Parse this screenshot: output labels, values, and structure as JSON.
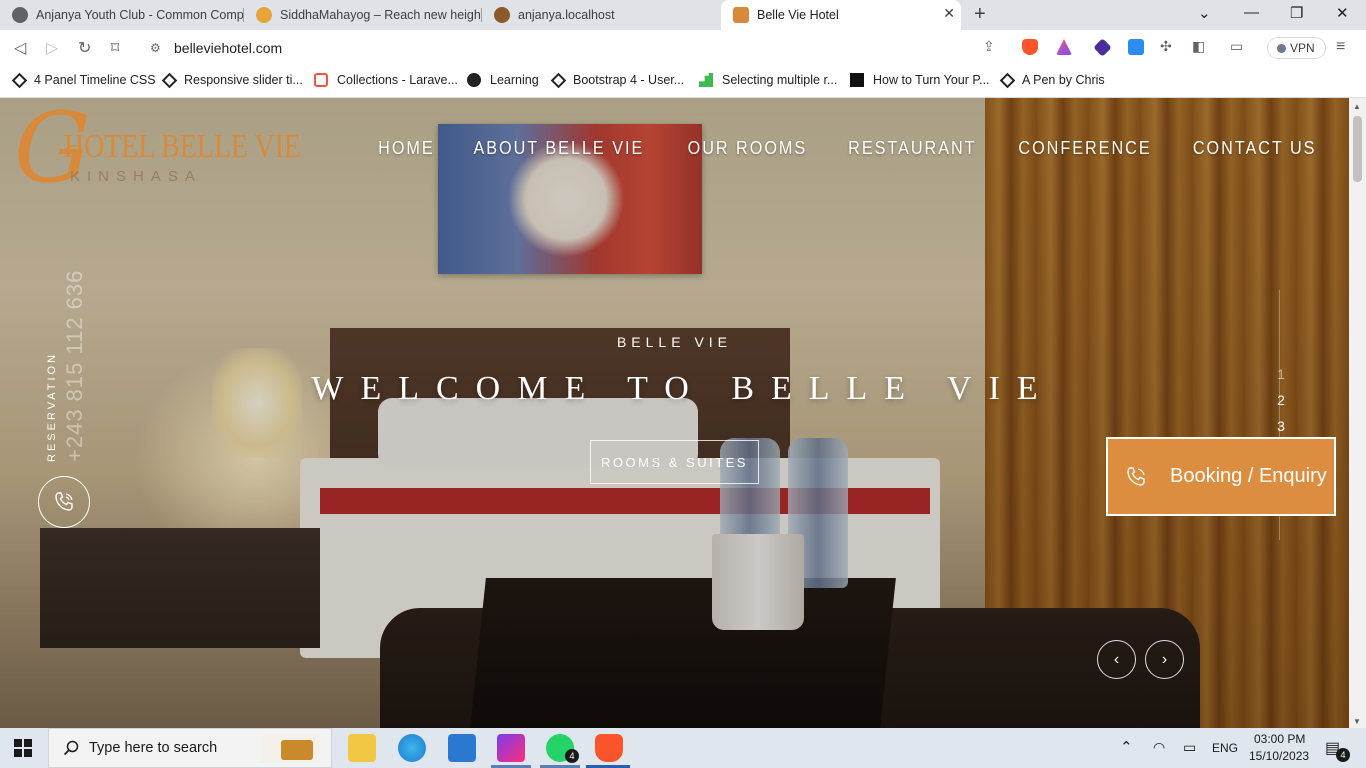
{
  "browser": {
    "tabs": [
      {
        "title": "Anjanya Youth Club - Common Comp",
        "favicon": "globe-icon",
        "active": false
      },
      {
        "title": "SiddhaMahayog – Reach new heights",
        "favicon": "siddhamahayog-icon",
        "active": false
      },
      {
        "title": "anjanya.localhost",
        "favicon": "anjanya-icon",
        "active": false
      },
      {
        "title": "Belle Vie Hotel",
        "favicon": "bellevie-icon",
        "active": true
      }
    ],
    "address": "belleviehotel.com",
    "vpn_label": "VPN",
    "bookmarks": [
      {
        "label": "4 Panel Timeline CSS",
        "icon": "codepen-icon"
      },
      {
        "label": "Responsive slider ti...",
        "icon": "codepen-icon"
      },
      {
        "label": "Collections - Larave...",
        "icon": "laravel-icon"
      },
      {
        "label": "Learning",
        "icon": "learning-icon"
      },
      {
        "label": "Bootstrap 4 - User...",
        "icon": "codepen-icon"
      },
      {
        "label": "Selecting multiple r...",
        "icon": "stackoverflow-icon"
      },
      {
        "label": "How to Turn Your P...",
        "icon": "medium-icon"
      },
      {
        "label": "A Pen by Chris",
        "icon": "codepen-icon"
      }
    ]
  },
  "site": {
    "logo": {
      "initial": "G",
      "main": "HOTEL BELLE VIE",
      "sub": "KINSHASA"
    },
    "nav": [
      "HOME",
      "ABOUT BELLE VIE",
      "OUR ROOMS",
      "RESTAURANT",
      "CONFERENCE",
      "CONTACT US"
    ],
    "reservation_label": "RESERVATION",
    "reservation_phone": "+243 815 112 636",
    "hero": {
      "kicker": "BELLE VIE",
      "title": "WELCOME TO BELLE VIE",
      "cta": "ROOMS & SUITES"
    },
    "pager": [
      "1",
      "2",
      "3"
    ],
    "active_slide": "2",
    "booking_label": "Booking / Enquiry",
    "accent_color": "#dd8d3f"
  },
  "taskbar": {
    "search_placeholder": "Type here to search",
    "whatsapp_badge": "4",
    "language": "ENG",
    "time": "03:00 PM",
    "date": "15/10/2023",
    "notification_count": "4"
  }
}
